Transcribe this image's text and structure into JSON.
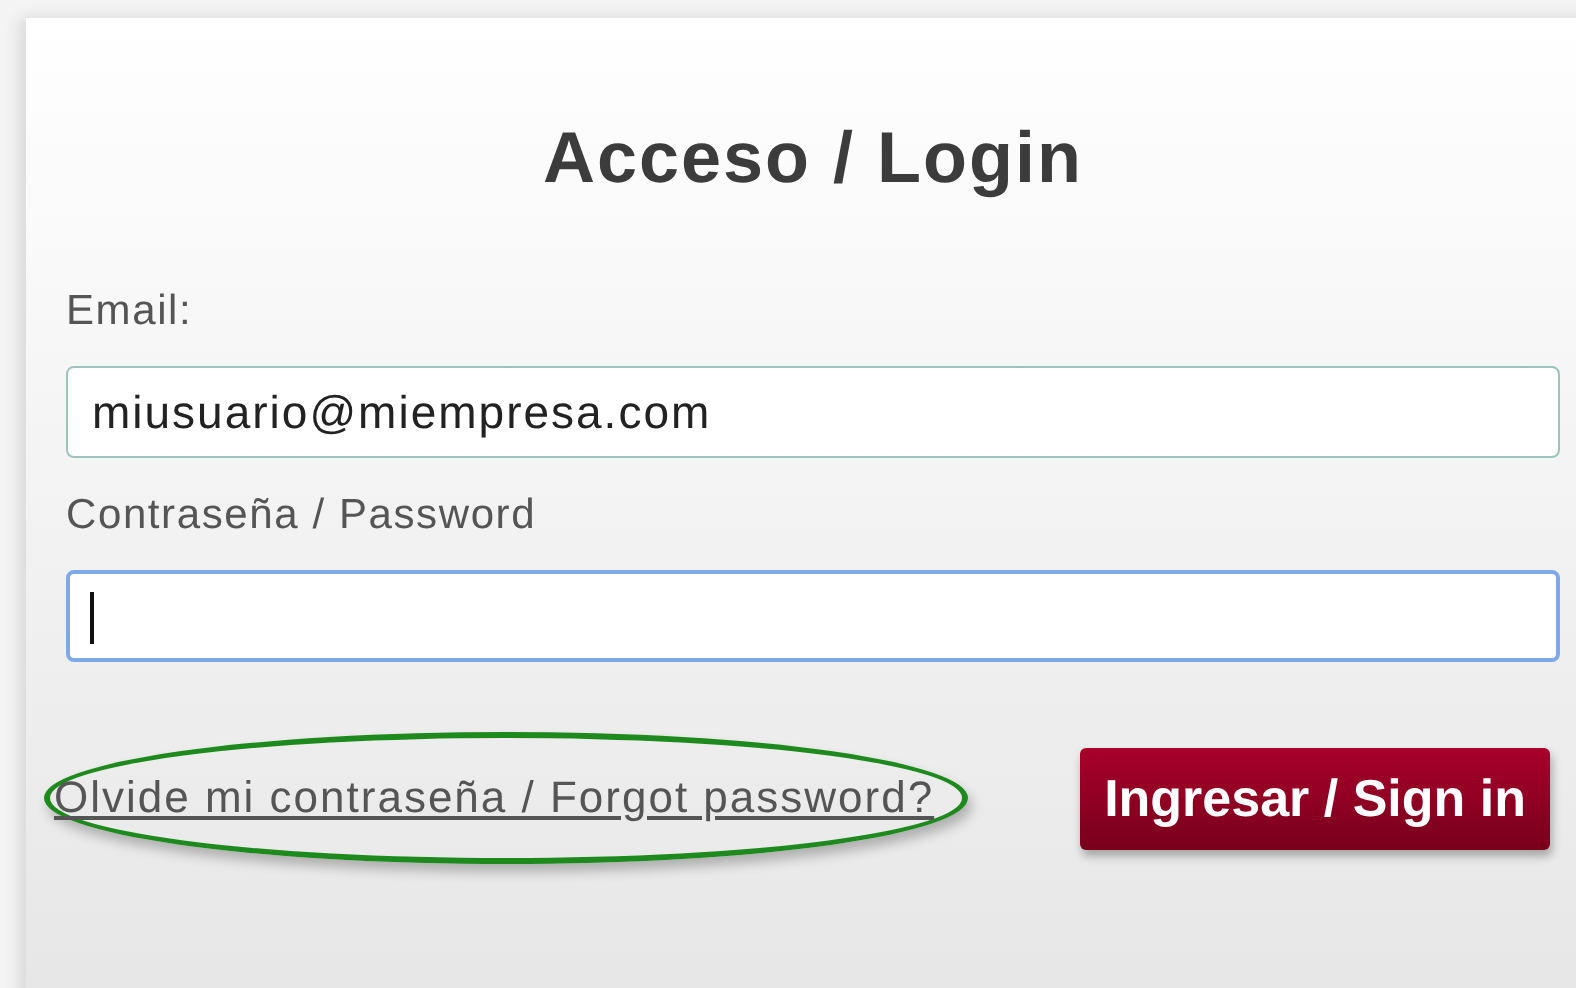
{
  "title": "Acceso / Login",
  "fields": [
    {
      "label": "Email:",
      "value": "miusuario@miempresa.com",
      "focused": false
    },
    {
      "label": "Contraseña / Password",
      "focused": true
    }
  ],
  "forgot_link": {
    "text": "Olvide mi contraseña / Forgot password?",
    "highlighted": true
  },
  "submit_button": "Ingresar / Sign in"
}
